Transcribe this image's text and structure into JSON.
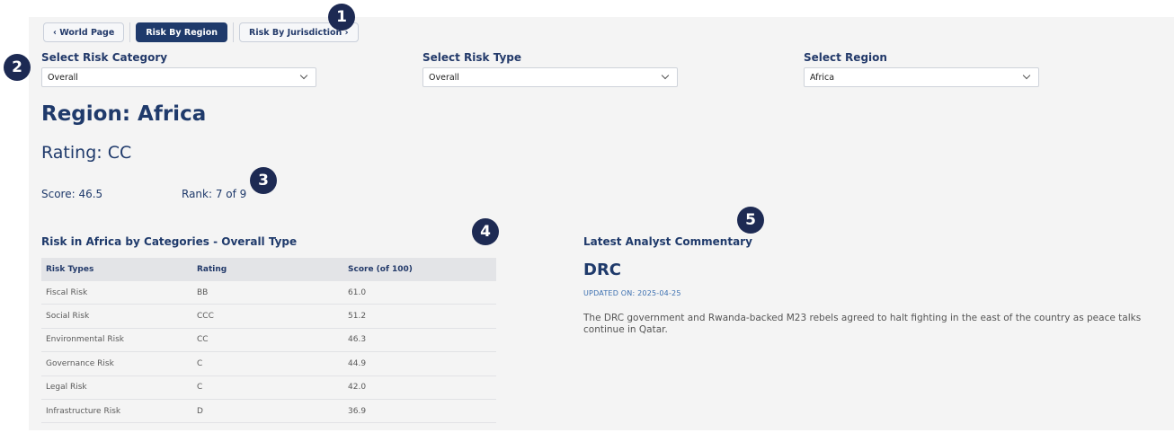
{
  "tabs": [
    {
      "label": "‹ World Page"
    },
    {
      "label": "Risk By Region"
    },
    {
      "label": "Risk By Jurisdiction ›"
    }
  ],
  "badges": [
    "1",
    "2",
    "3",
    "4",
    "5"
  ],
  "filters": {
    "category": {
      "label": "Select Risk Category",
      "value": "Overall"
    },
    "type": {
      "label": "Select Risk Type",
      "value": "Overall"
    },
    "region": {
      "label": "Select Region",
      "value": "Africa"
    }
  },
  "summary": {
    "title": "Region: Africa",
    "rating": "Rating: CC",
    "score": "Score: 46.5",
    "rank": "Rank: 7 of 9"
  },
  "table": {
    "title": "Risk in Africa by Categories - Overall Type",
    "headers": [
      "Risk Types",
      "Rating",
      "Score (of 100)"
    ],
    "rows": [
      [
        "Fiscal Risk",
        "BB",
        "61.0"
      ],
      [
        "Social Risk",
        "CCC",
        "51.2"
      ],
      [
        "Environmental Risk",
        "CC",
        "46.3"
      ],
      [
        "Governance Risk",
        "C",
        "44.9"
      ],
      [
        "Legal Risk",
        "C",
        "42.0"
      ],
      [
        "Infrastructure Risk",
        "D",
        "36.9"
      ]
    ]
  },
  "commentary": {
    "title": "Latest Analyst Commentary",
    "subject": "DRC",
    "updated": "UPDATED ON: 2025-04-25",
    "body": "The DRC government and Rwanda-backed M23 rebels agreed to halt fighting in the east of the country as peace talks continue in Qatar."
  },
  "colors": {
    "primary": "#1f3a6b",
    "badge": "#1d2a53",
    "panel": "#f4f4f4",
    "accent_link": "#3b6fb0"
  }
}
